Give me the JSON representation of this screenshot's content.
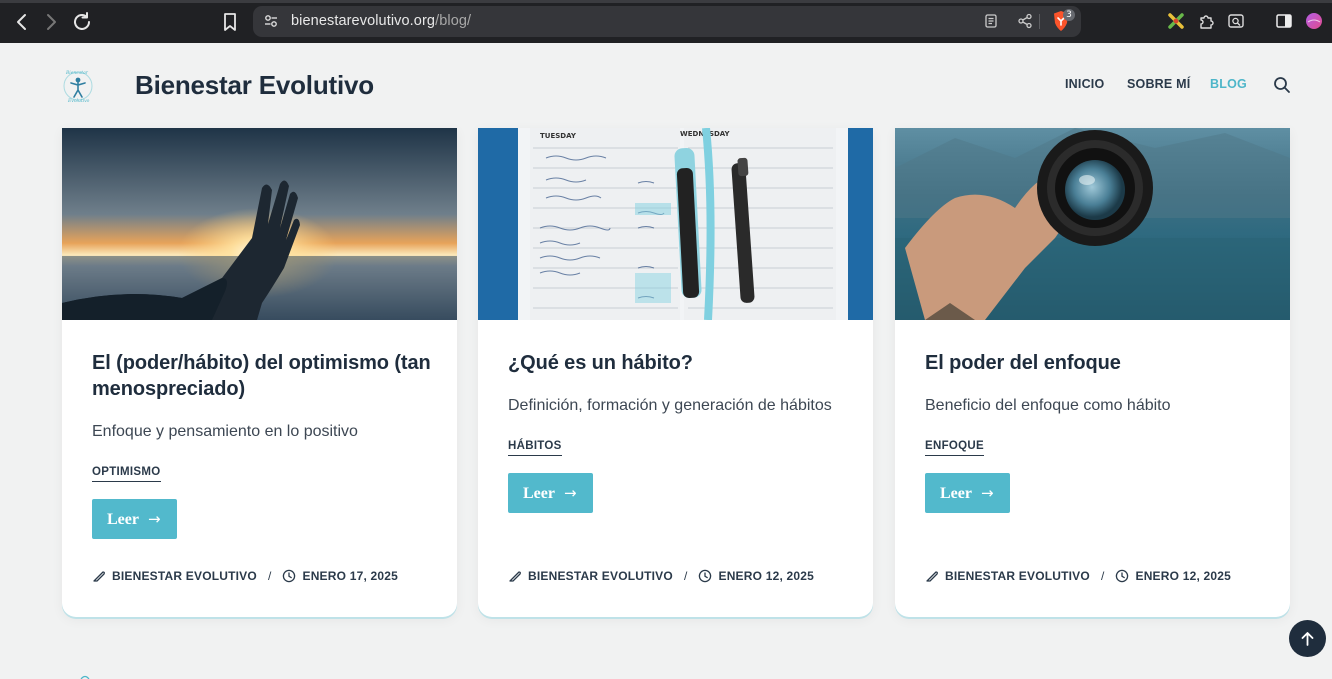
{
  "browser": {
    "url_domain": "bienestarevolutivo.org",
    "url_path": "/blog/",
    "shield_count": "3",
    "icons": [
      "back-icon",
      "forward-icon",
      "reload-icon",
      "bookmark-icon",
      "site-settings-icon",
      "reader-mode-icon",
      "share-icon",
      "brave-shield-icon",
      "extension-icon",
      "puzzle-icon",
      "screenshot-icon",
      "sidebar-icon",
      "profile-icon"
    ]
  },
  "site": {
    "title": "Bienestar Evolutivo",
    "logo_icon": "stick-figure-logo",
    "menu": [
      {
        "label": "INICIO",
        "active": false
      },
      {
        "label": "SOBRE MÍ",
        "active": false
      },
      {
        "label": "BLOG",
        "active": true
      }
    ],
    "accent_color": "#52b9cc",
    "text_color": "#1f2d3d"
  },
  "posts": [
    {
      "title": "El (poder/hábito) del optimismo (tan menospreciado)",
      "excerpt": "Enfoque y pensamiento en lo positivo",
      "category": "OPTIMISMO",
      "button": "Leer",
      "author": "BIENESTAR EVOLUTIVO",
      "date": "ENERO 17, 2025",
      "image": "hand-reaching-sunset"
    },
    {
      "title": "¿Qué es un hábito?",
      "excerpt": "Definición, formación y generación de hábitos",
      "category": "HÁBITOS",
      "button": "Leer",
      "author": "BIENESTAR EVOLUTIVO",
      "date": "ENERO 12, 2025",
      "image": "planner-notebook-pens"
    },
    {
      "title": "El poder del enfoque",
      "excerpt": "Beneficio del enfoque como hábito",
      "category": "ENFOQUE",
      "button": "Leer",
      "author": "BIENESTAR EVOLUTIVO",
      "date": "ENERO 12, 2025",
      "image": "hand-holding-camera-lens"
    }
  ],
  "date_separator": "/"
}
